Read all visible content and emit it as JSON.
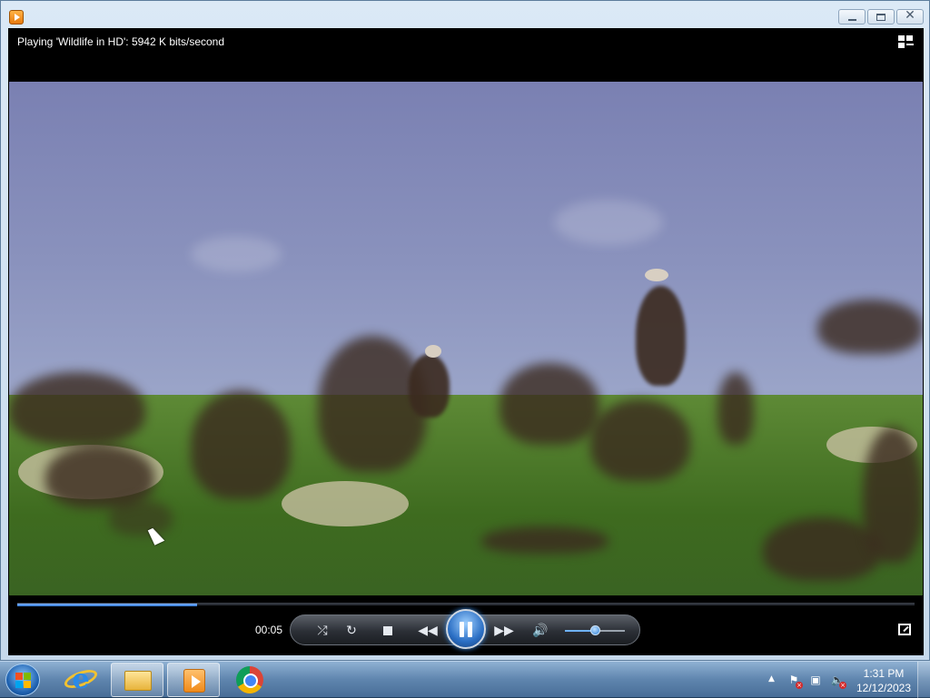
{
  "window": {
    "app_icon": "windows-media-player-icon",
    "controls": [
      "minimize",
      "maximize",
      "close"
    ]
  },
  "player": {
    "status_text": "Playing 'Wildlife in HD': 5942 K bits/second",
    "elapsed_time": "00:05",
    "playback_progress": 0.2,
    "volume_level": 0.5,
    "state": "playing",
    "icons": [
      "switch-to-library-icon",
      "shuffle-icon",
      "repeat-icon",
      "stop-icon",
      "previous-icon",
      "pause-icon",
      "next-icon",
      "mute-icon",
      "fullscreen-icon"
    ],
    "accent_color": "#3d8ee8"
  },
  "taskbar": {
    "items": [
      {
        "name": "internet-explorer",
        "icon": "internet-explorer-icon",
        "active": false
      },
      {
        "name": "windows-explorer",
        "icon": "folder-icon",
        "active": true
      },
      {
        "name": "windows-media-player",
        "icon": "media-player-icon",
        "active": true
      },
      {
        "name": "google-chrome",
        "icon": "chrome-icon",
        "active": false
      }
    ],
    "tray_icons": [
      "show-hidden-icons-arrow",
      "action-center-flag-icon",
      "network-icon",
      "volume-muted-icon"
    ],
    "clock": {
      "time": "1:31 PM",
      "date": "12/12/2023"
    }
  }
}
